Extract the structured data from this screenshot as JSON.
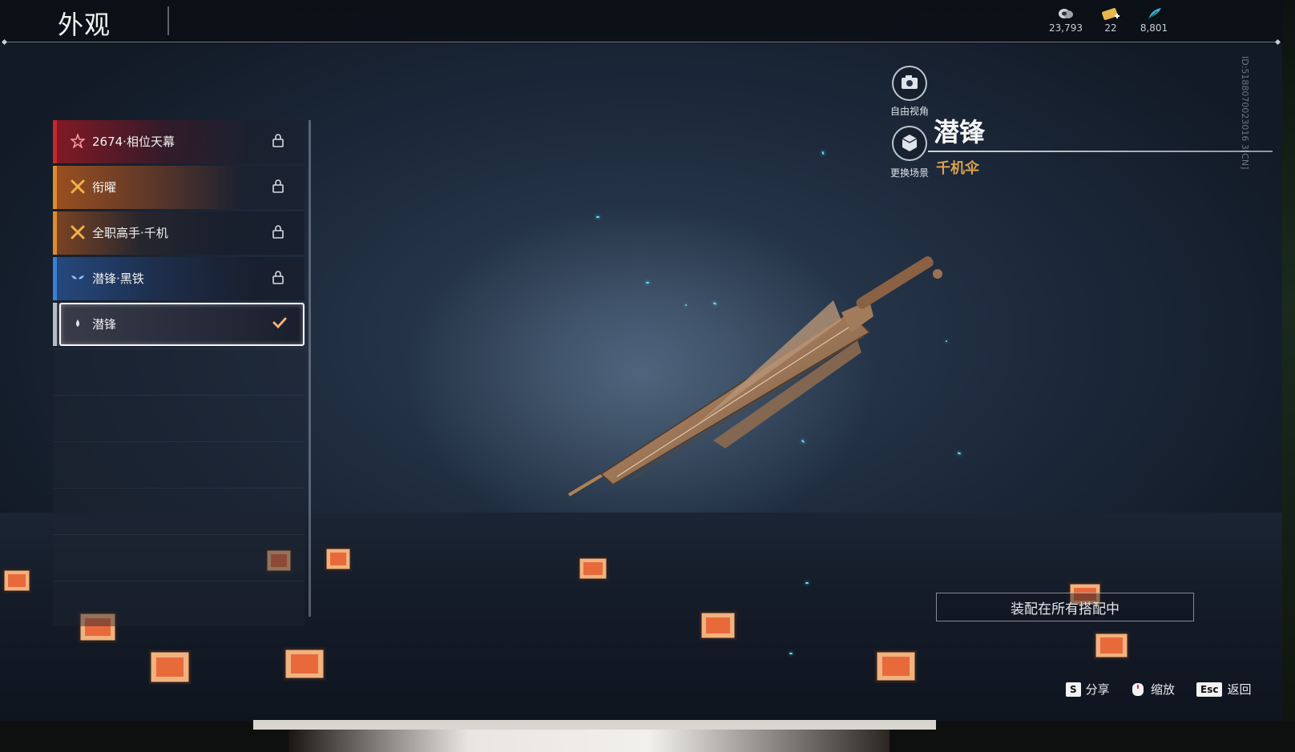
{
  "header": {
    "title": "外观",
    "currencies": [
      {
        "icon": "coin-stack-icon",
        "amount": "23,793"
      },
      {
        "icon": "ticket-icon",
        "amount": "22"
      },
      {
        "icon": "feather-icon",
        "amount": "8,801"
      }
    ]
  },
  "vertical_id": "ID:5188070023016 3[CN]",
  "skins": [
    {
      "label": "2674·相位天幕",
      "rarity_color": "#c8262f",
      "icon": "star-icon",
      "locked": true
    },
    {
      "label": "衔曜",
      "rarity_color": "#e08b2a",
      "icon": "gold-flower-icon",
      "locked": true
    },
    {
      "label": "全职高手·千机",
      "rarity_color": "#e08b2a",
      "icon": "gold-flower-icon",
      "locked": true
    },
    {
      "label": "潜锋·黑铁",
      "rarity_color": "#3a7fd6",
      "icon": "blue-wings-icon",
      "locked": true
    },
    {
      "label": "潜锋",
      "rarity_color": "#b8bcc4",
      "icon": "drop-icon",
      "locked": false,
      "selected": true
    }
  ],
  "camera": {
    "free_view": "自由视角",
    "change_scene": "更换场景"
  },
  "item": {
    "name": "潜锋",
    "type": "千机伞",
    "type_color": "#d8a24e"
  },
  "equip_all_label": "装配在所有搭配中",
  "hints": [
    {
      "key": "S",
      "label": "分享"
    },
    {
      "key": "mouse",
      "label": "缩放"
    },
    {
      "key": "Esc",
      "label": "返回"
    }
  ]
}
